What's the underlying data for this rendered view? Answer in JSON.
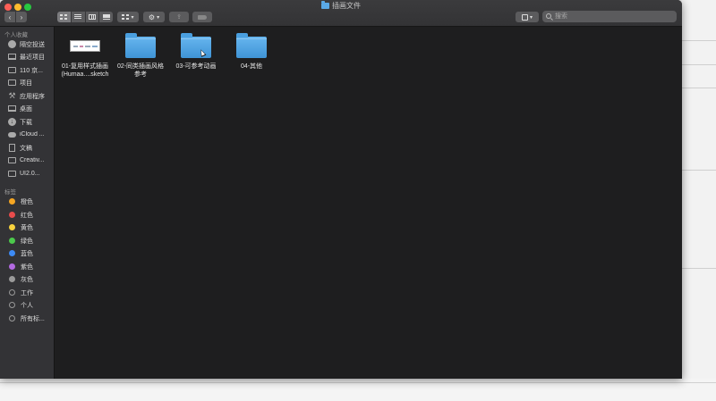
{
  "window": {
    "title": "插画文件"
  },
  "search": {
    "placeholder": "搜索"
  },
  "sidebar": {
    "favorites_header": "个人收藏",
    "tags_header": "标签",
    "favorites": [
      {
        "label": "隔空投送",
        "icon": "airdrop-icon"
      },
      {
        "label": "最近项目",
        "icon": "recents-icon"
      },
      {
        "label": "110 京...",
        "icon": "folder-icon"
      },
      {
        "label": "项目",
        "icon": "folder-icon"
      },
      {
        "label": "应用程序",
        "icon": "applications-icon"
      },
      {
        "label": "桌面",
        "icon": "desktop-icon"
      },
      {
        "label": "下载",
        "icon": "downloads-icon"
      },
      {
        "label": "iCloud ...",
        "icon": "cloud-icon"
      },
      {
        "label": "文稿",
        "icon": "document-icon"
      },
      {
        "label": "Creativ...",
        "icon": "folder-icon"
      },
      {
        "label": "UI2.0...",
        "icon": "folder-icon"
      }
    ],
    "tags": [
      {
        "label": "橙色",
        "color": "#f5a623"
      },
      {
        "label": "红色",
        "color": "#e84c4c"
      },
      {
        "label": "黄色",
        "color": "#f7d23e"
      },
      {
        "label": "绿色",
        "color": "#4cc94c"
      },
      {
        "label": "蓝色",
        "color": "#3d8bf5"
      },
      {
        "label": "紫色",
        "color": "#b36ae2"
      },
      {
        "label": "灰色",
        "color": "#9a9a9a"
      },
      {
        "label": "工作",
        "color": ""
      },
      {
        "label": "个人",
        "color": ""
      },
      {
        "label": "所有标...",
        "color": ""
      }
    ]
  },
  "files": [
    {
      "name_line1": "01-复用样式插画",
      "name_line2": "(Humaa....sketch",
      "type": "sketch"
    },
    {
      "name_line1": "02-同类插画风格",
      "name_line2": "参考",
      "type": "folder"
    },
    {
      "name_line1": "03-可参考动画",
      "name_line2": "",
      "type": "folder"
    },
    {
      "name_line1": "04-其他",
      "name_line2": "",
      "type": "folder"
    }
  ],
  "colors": {
    "folder_blue": "#4a9fdf",
    "sidebar_bg": "#333336",
    "content_bg": "#1e1e1f"
  }
}
